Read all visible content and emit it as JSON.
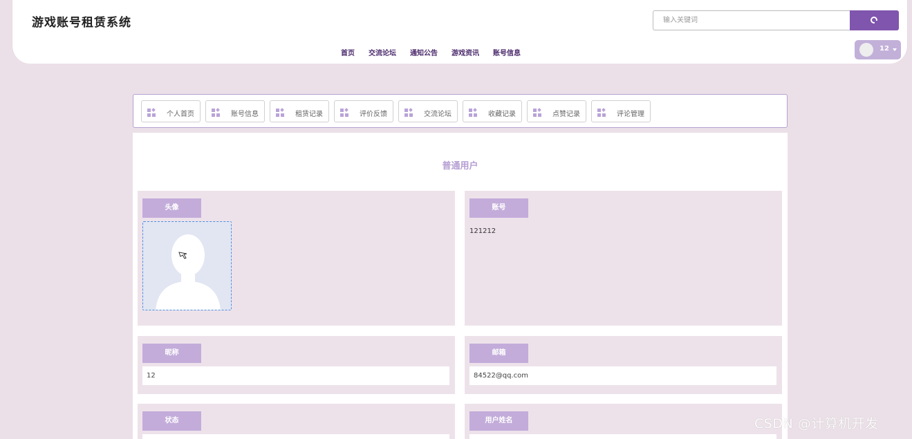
{
  "header": {
    "site_title": "游戏账号租赁系统",
    "search_placeholder": "输入关键词",
    "nav": [
      "首页",
      "交流论坛",
      "通知公告",
      "游戏资讯",
      "账号信息"
    ],
    "user_name": "12"
  },
  "tabs": [
    "个人首页",
    "账号信息",
    "租赁记录",
    "评价反馈",
    "交流论坛",
    "收藏记录",
    "点赞记录",
    "评论管理"
  ],
  "profile": {
    "section_title": "普通用户",
    "avatar_label": "头像",
    "account_label": "账号",
    "account_value": "121212",
    "nickname_label": "昵称",
    "nickname_value": "12",
    "email_label": "邮箱",
    "email_value": "84522@qq.com",
    "status_label": "状态",
    "realname_label": "用户姓名"
  },
  "watermark": "CSDN @计算机开发",
  "colors": {
    "accent": "#7f55ad",
    "label_bg": "#c3acda",
    "page_bg": "#ece0e8",
    "card_bg": "#ede2ea"
  },
  "icons": {
    "search": "search-icon",
    "tab": "grid-icon",
    "avatar": "user-avatar-icon",
    "caret": "caret-down-icon"
  }
}
